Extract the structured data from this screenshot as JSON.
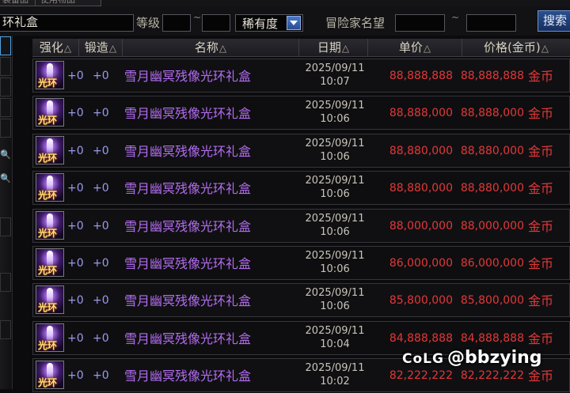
{
  "tabs": [
    "装备品",
    "使用物品"
  ],
  "search": {
    "item_name": "环礼盒",
    "level_label": "等级",
    "level_min": "",
    "level_max": "",
    "tilde": "~",
    "rarity_value": "稀有度",
    "adventurer_label": "冒险家名望",
    "adv_min": "",
    "adv_max": "",
    "search_button": "搜索"
  },
  "table": {
    "headers": {
      "enhance": "强化",
      "forge": "锻造",
      "name": "名称",
      "date": "日期",
      "unit_price": "单价",
      "total_price": "价格(金币)"
    },
    "sort_glyph": "△",
    "rows": [
      {
        "icon_badge": "光环",
        "enhance": "+0",
        "forge": "+0",
        "name": "雪月幽冥残像光环礼盒",
        "date": "2025/09/11",
        "time": "10:07",
        "unit_price": "88,888,888",
        "total_price": "88,888,888",
        "currency": "金币"
      },
      {
        "icon_badge": "光环",
        "enhance": "+0",
        "forge": "+0",
        "name": "雪月幽冥残像光环礼盒",
        "date": "2025/09/11",
        "time": "10:06",
        "unit_price": "88,888,000",
        "total_price": "88,888,000",
        "currency": "金币"
      },
      {
        "icon_badge": "光环",
        "enhance": "+0",
        "forge": "+0",
        "name": "雪月幽冥残像光环礼盒",
        "date": "2025/09/11",
        "time": "10:06",
        "unit_price": "88,880,000",
        "total_price": "88,880,000",
        "currency": "金币"
      },
      {
        "icon_badge": "光环",
        "enhance": "+0",
        "forge": "+0",
        "name": "雪月幽冥残像光环礼盒",
        "date": "2025/09/11",
        "time": "10:06",
        "unit_price": "88,880,000",
        "total_price": "88,880,000",
        "currency": "金币"
      },
      {
        "icon_badge": "光环",
        "enhance": "+0",
        "forge": "+0",
        "name": "雪月幽冥残像光环礼盒",
        "date": "2025/09/11",
        "time": "10:06",
        "unit_price": "88,000,000",
        "total_price": "88,000,000",
        "currency": "金币"
      },
      {
        "icon_badge": "光环",
        "enhance": "+0",
        "forge": "+0",
        "name": "雪月幽冥残像光环礼盒",
        "date": "2025/09/11",
        "time": "10:06",
        "unit_price": "86,000,000",
        "total_price": "86,000,000",
        "currency": "金币"
      },
      {
        "icon_badge": "光环",
        "enhance": "+0",
        "forge": "+0",
        "name": "雪月幽冥残像光环礼盒",
        "date": "2025/09/11",
        "time": "10:06",
        "unit_price": "85,800,000",
        "total_price": "85,800,000",
        "currency": "金币"
      },
      {
        "icon_badge": "光环",
        "enhance": "+0",
        "forge": "+0",
        "name": "雪月幽冥残像光环礼盒",
        "date": "2025/09/11",
        "time": "10:04",
        "unit_price": "84,888,888",
        "total_price": "84,888,888",
        "currency": "金币"
      },
      {
        "icon_badge": "光环",
        "enhance": "+0",
        "forge": "+0",
        "name": "雪月幽冥残像光环礼盒",
        "date": "2025/09/11",
        "time": "10:02",
        "unit_price": "82,222,222",
        "total_price": "82,222,222",
        "currency": "金币"
      }
    ]
  },
  "watermark": {
    "logo": "CoLG",
    "handle": "@bbzying"
  },
  "colors": {
    "name_purple": "#b36cf0",
    "price_red": "#e23838",
    "accent_blue": "#4fa3e0"
  }
}
